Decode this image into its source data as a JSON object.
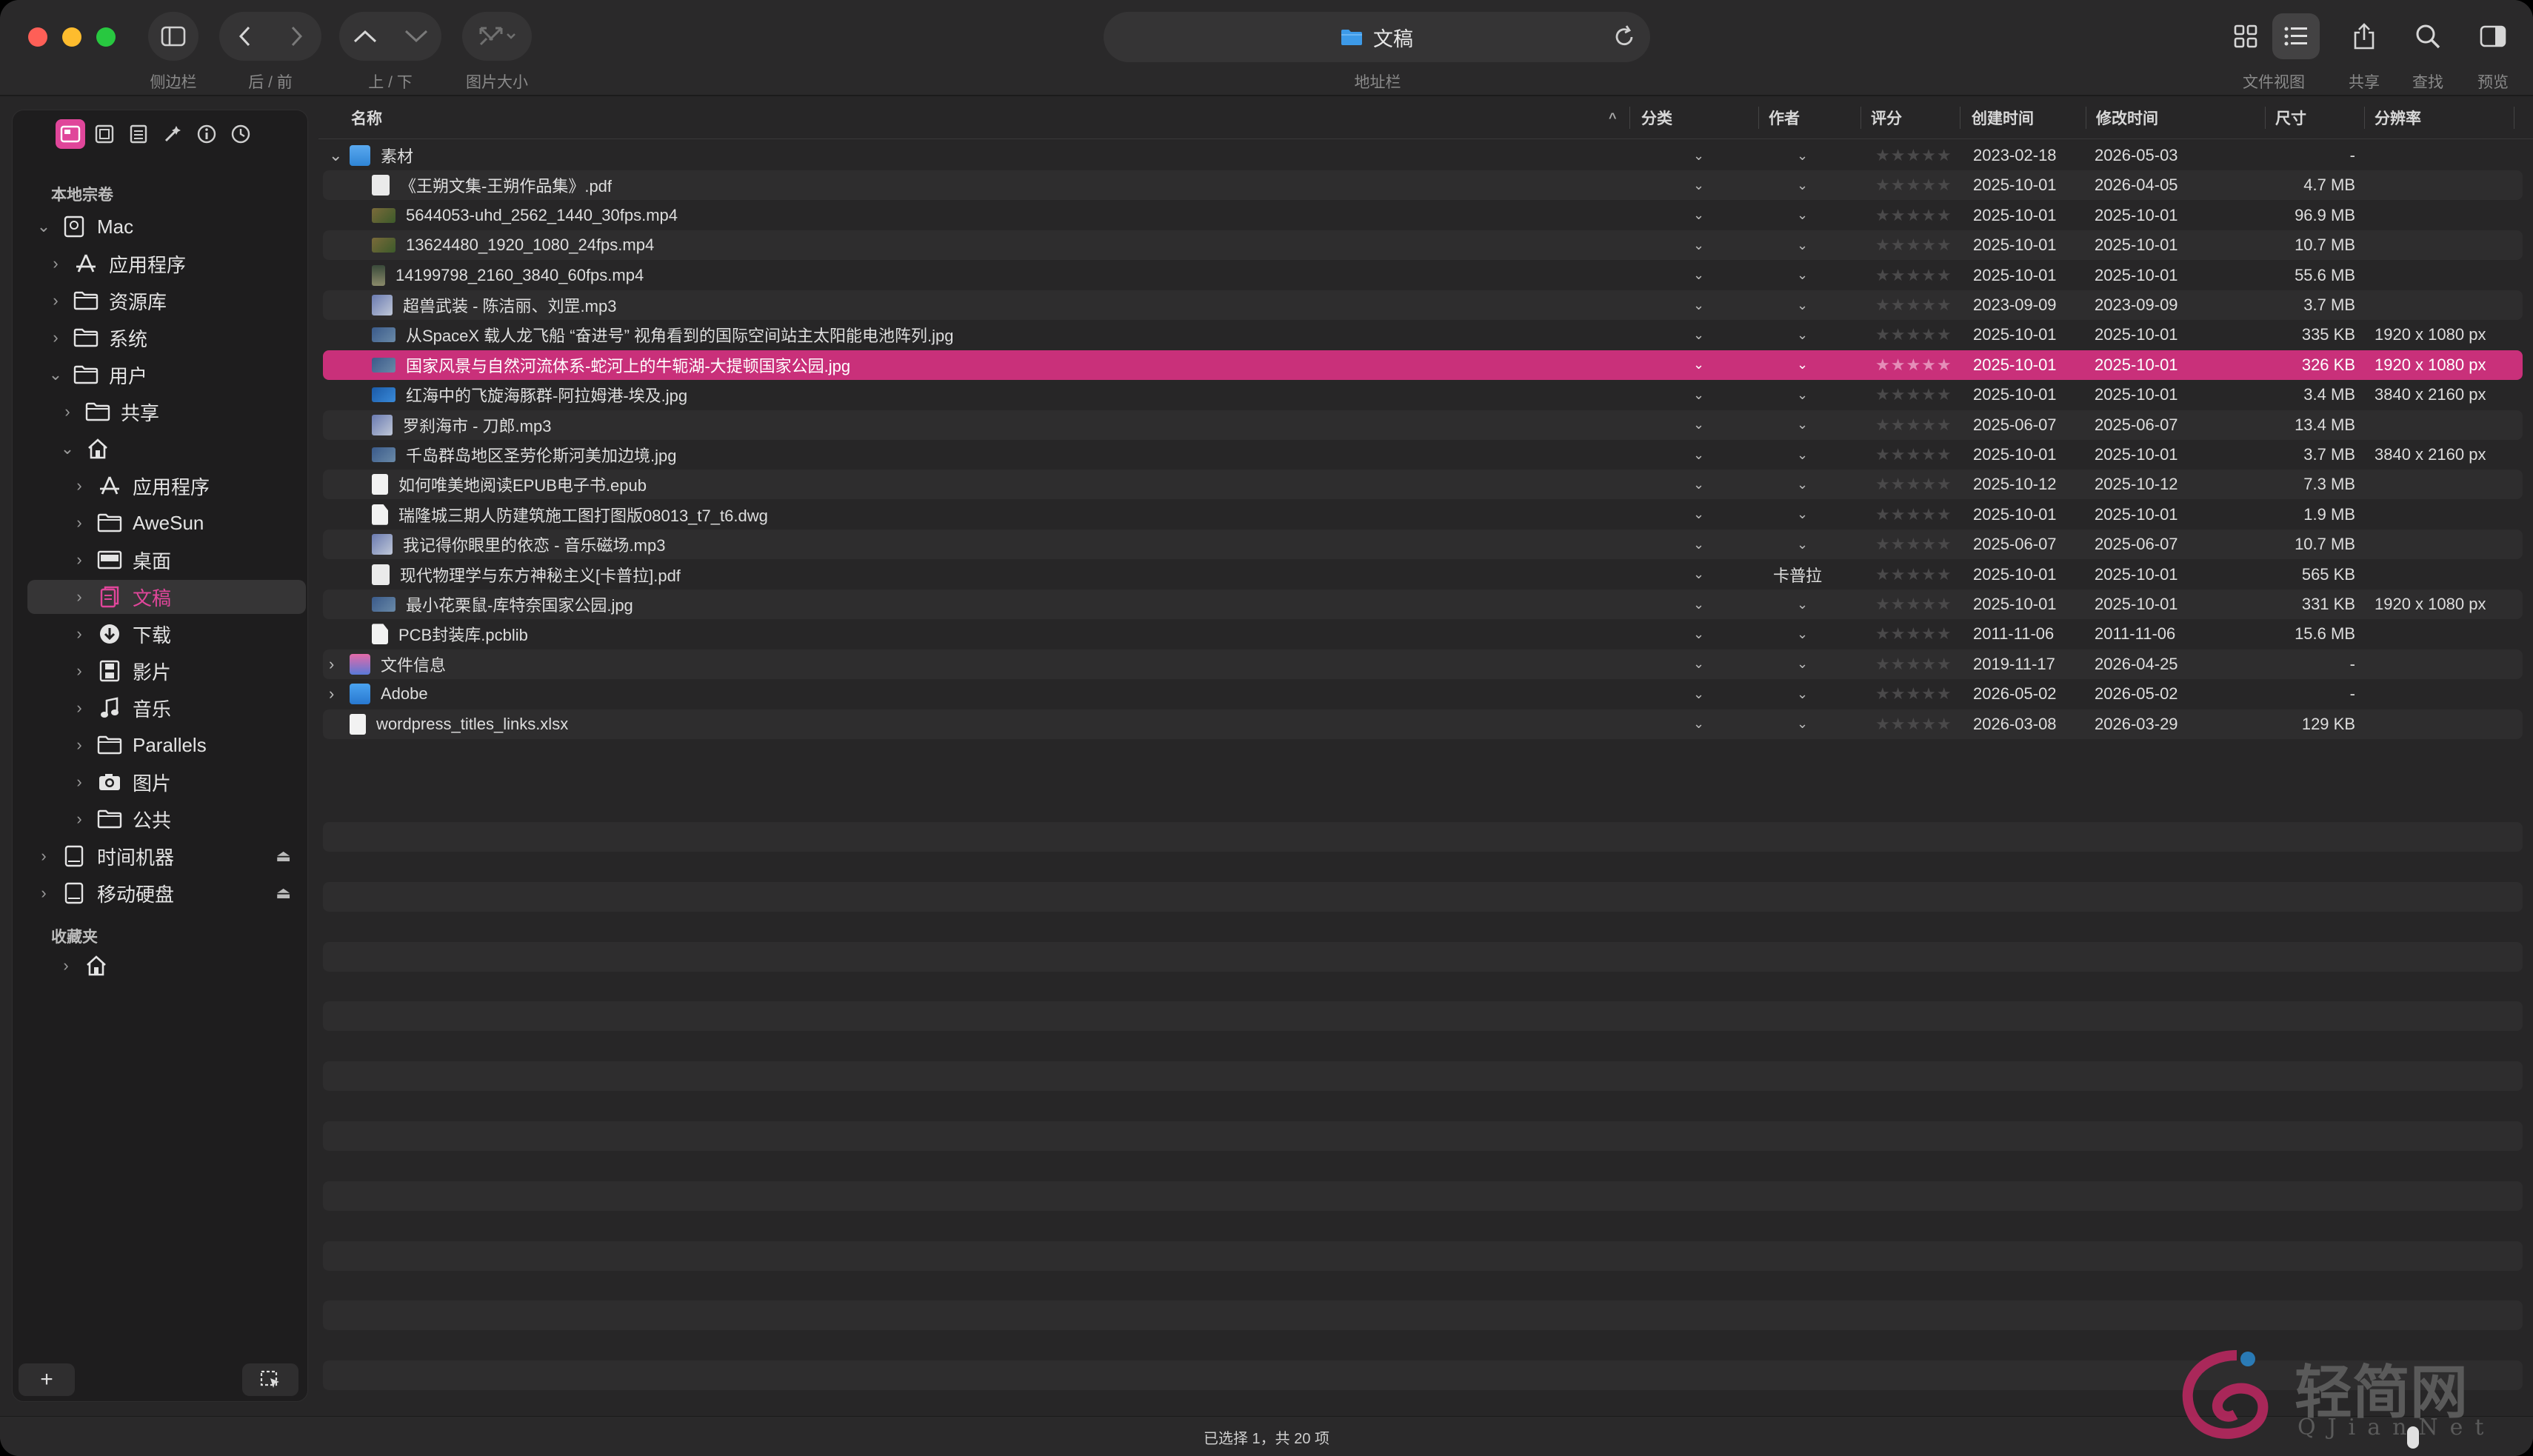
{
  "toolbar": {
    "labels": {
      "sidebar": "侧边栏",
      "back_forward": "后 / 前",
      "up_down": "上 / 下",
      "image_size": "图片大小",
      "address": "地址栏",
      "file_view": "文件视图",
      "share": "共享",
      "find": "查找",
      "preview": "预览"
    },
    "address_title": "文稿"
  },
  "sidebar": {
    "section_local": "本地宗卷",
    "section_fav": "收藏夹",
    "items": [
      {
        "label": "Mac",
        "depth": 0,
        "open": true,
        "icon": "mac-disk-icon"
      },
      {
        "label": "应用程序",
        "depth": 1,
        "open": false,
        "icon": "apps-icon"
      },
      {
        "label": "资源库",
        "depth": 1,
        "open": false,
        "icon": "folder-icon"
      },
      {
        "label": "系统",
        "depth": 1,
        "open": false,
        "icon": "folder-icon"
      },
      {
        "label": "用户",
        "depth": 1,
        "open": true,
        "icon": "folder-icon"
      },
      {
        "label": "共享",
        "depth": 2,
        "open": false,
        "icon": "folder-icon"
      },
      {
        "label": "",
        "depth": 2,
        "open": true,
        "icon": "home-icon"
      },
      {
        "label": "应用程序",
        "depth": 3,
        "open": false,
        "icon": "apps-icon"
      },
      {
        "label": "AweSun",
        "depth": 3,
        "open": false,
        "icon": "folder-icon"
      },
      {
        "label": "桌面",
        "depth": 3,
        "open": false,
        "icon": "desktop-icon"
      },
      {
        "label": "文稿",
        "depth": 3,
        "open": false,
        "icon": "documents-icon",
        "selected": true
      },
      {
        "label": "下载",
        "depth": 3,
        "open": false,
        "icon": "download-icon"
      },
      {
        "label": "影片",
        "depth": 3,
        "open": false,
        "icon": "film-icon"
      },
      {
        "label": "音乐",
        "depth": 3,
        "open": false,
        "icon": "music-icon"
      },
      {
        "label": "Parallels",
        "depth": 3,
        "open": false,
        "icon": "folder-icon"
      },
      {
        "label": "图片",
        "depth": 3,
        "open": false,
        "icon": "camera-icon"
      },
      {
        "label": "公共",
        "depth": 3,
        "open": false,
        "icon": "folder-icon"
      },
      {
        "label": "时间机器",
        "depth": 0,
        "open": false,
        "icon": "disk-icon",
        "eject": true
      },
      {
        "label": "移动硬盘",
        "depth": 0,
        "open": false,
        "icon": "disk-icon",
        "eject": true
      }
    ],
    "fav_items": [
      {
        "label": "",
        "icon": "home-icon"
      }
    ]
  },
  "columns": {
    "name": "名称",
    "category": "分类",
    "author": "作者",
    "rating": "评分",
    "created": "创建时间",
    "modified": "修改时间",
    "size": "尺寸",
    "resolution": "分辨率"
  },
  "files": [
    {
      "name": "素材",
      "indent": 0,
      "disclosure": "open",
      "icon": "folder",
      "author": "",
      "rated": 0,
      "created": "2023-02-18",
      "modified": "2026-05-03",
      "size": "-",
      "res": ""
    },
    {
      "name": "《王朔文集-王朔作品集》.pdf",
      "indent": 1,
      "icon": "pdf",
      "author": "",
      "rated": 0,
      "created": "2025-10-01",
      "modified": "2026-04-05",
      "size": "4.7 MB",
      "res": ""
    },
    {
      "name": "5644053-uhd_2562_1440_30fps.mp4",
      "indent": 1,
      "icon": "video",
      "author": "",
      "rated": 0,
      "created": "2025-10-01",
      "modified": "2025-10-01",
      "size": "96.9 MB",
      "res": ""
    },
    {
      "name": "13624480_1920_1080_24fps.mp4",
      "indent": 1,
      "icon": "video",
      "author": "",
      "rated": 0,
      "created": "2025-10-01",
      "modified": "2025-10-01",
      "size": "10.7 MB",
      "res": ""
    },
    {
      "name": "14199798_2160_3840_60fps.mp4",
      "indent": 1,
      "icon": "video-v",
      "author": "",
      "rated": 0,
      "created": "2025-10-01",
      "modified": "2025-10-01",
      "size": "55.6 MB",
      "res": ""
    },
    {
      "name": "超兽武装 - 陈洁丽、刘罡.mp3",
      "indent": 1,
      "icon": "audio",
      "author": "",
      "rated": 0,
      "created": "2023-09-09",
      "modified": "2023-09-09",
      "size": "3.7 MB",
      "res": ""
    },
    {
      "name": "从SpaceX 载人龙飞船 “奋进号” 视角看到的国际空间站主太阳能电池阵列.jpg",
      "indent": 1,
      "icon": "image",
      "author": "",
      "rated": 0,
      "created": "2025-10-01",
      "modified": "2025-10-01",
      "size": "335 KB",
      "res": "1920 x 1080 px"
    },
    {
      "name": "国家风景与自然河流体系-蛇河上的牛轭湖-大提顿国家公园.jpg",
      "indent": 1,
      "icon": "image",
      "author": "",
      "rated": 0,
      "created": "2025-10-01",
      "modified": "2025-10-01",
      "size": "326 KB",
      "res": "1920 x 1080 px",
      "selected": true
    },
    {
      "name": "红海中的飞旋海豚群-阿拉姆港-埃及.jpg",
      "indent": 1,
      "icon": "image-blue",
      "author": "",
      "rated": 0,
      "created": "2025-10-01",
      "modified": "2025-10-01",
      "size": "3.4 MB",
      "res": "3840 x 2160 px"
    },
    {
      "name": "罗刹海市 - 刀郎.mp3",
      "indent": 1,
      "icon": "audio",
      "author": "",
      "rated": 0,
      "created": "2025-06-07",
      "modified": "2025-06-07",
      "size": "13.4 MB",
      "res": ""
    },
    {
      "name": "千岛群岛地区圣劳伦斯河美加边境.jpg",
      "indent": 1,
      "icon": "image",
      "author": "",
      "rated": 0,
      "created": "2025-10-01",
      "modified": "2025-10-01",
      "size": "3.7 MB",
      "res": "3840 x 2160 px"
    },
    {
      "name": "如何唯美地阅读EPUB电子书.epub",
      "indent": 1,
      "icon": "doc",
      "author": "",
      "rated": 0,
      "created": "2025-10-12",
      "modified": "2025-10-12",
      "size": "7.3 MB",
      "res": ""
    },
    {
      "name": "瑞隆城三期人防建筑施工图打图版08013_t7_t6.dwg",
      "indent": 1,
      "icon": "blank",
      "author": "",
      "rated": 0,
      "created": "2025-10-01",
      "modified": "2025-10-01",
      "size": "1.9 MB",
      "res": ""
    },
    {
      "name": "我记得你眼里的依恋 - 音乐磁场.mp3",
      "indent": 1,
      "icon": "audio",
      "author": "",
      "rated": 0,
      "created": "2025-06-07",
      "modified": "2025-06-07",
      "size": "10.7 MB",
      "res": ""
    },
    {
      "name": "现代物理学与东方神秘主义[卡普拉].pdf",
      "indent": 1,
      "icon": "pdf",
      "author": "卡普拉",
      "rated": 0,
      "created": "2025-10-01",
      "modified": "2025-10-01",
      "size": "565 KB",
      "res": ""
    },
    {
      "name": "最小花栗鼠-库特奈国家公园.jpg",
      "indent": 1,
      "icon": "image",
      "author": "",
      "rated": 0,
      "created": "2025-10-01",
      "modified": "2025-10-01",
      "size": "331 KB",
      "res": "1920 x 1080 px"
    },
    {
      "name": "PCB封装库.pcblib",
      "indent": 1,
      "icon": "blank",
      "author": "",
      "rated": 0,
      "created": "2011-11-06",
      "modified": "2011-11-06",
      "size": "15.6 MB",
      "res": ""
    },
    {
      "name": "文件信息",
      "indent": 0,
      "disclosure": "closed",
      "icon": "folder-pink",
      "author": "",
      "rated": 0,
      "created": "2019-11-17",
      "modified": "2026-04-25",
      "size": "-",
      "res": ""
    },
    {
      "name": "Adobe",
      "indent": 0,
      "disclosure": "closed",
      "icon": "folder-blue",
      "author": "",
      "rated": 0,
      "created": "2026-05-02",
      "modified": "2026-05-02",
      "size": "-",
      "res": ""
    },
    {
      "name": "wordpress_titles_links.xlsx",
      "indent": 0,
      "icon": "doc",
      "author": "",
      "rated": 0,
      "created": "2026-03-08",
      "modified": "2026-03-29",
      "size": "129 KB",
      "res": ""
    }
  ],
  "status": {
    "text": "已选择 1，共 20 项"
  },
  "watermark": {
    "cn": "轻简网",
    "en": "QJianNet"
  },
  "colors": {
    "accent": "#c9307a",
    "sidebar_selected_text": "#e0469a"
  }
}
